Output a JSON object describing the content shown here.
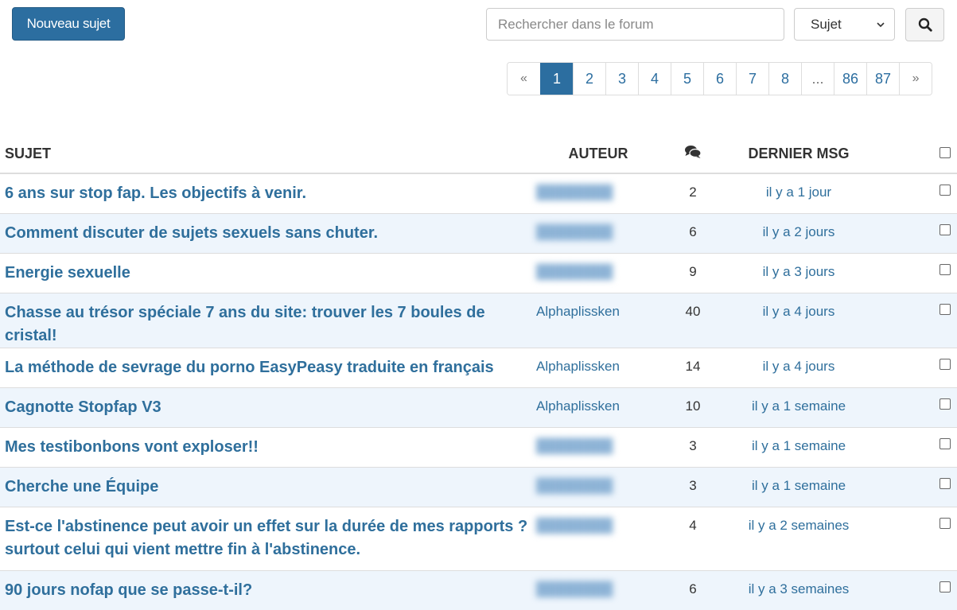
{
  "toolbar": {
    "new_topic_label": "Nouveau sujet",
    "search_placeholder": "Rechercher dans le forum",
    "search_scope_value": "Sujet",
    "search_button_icon": "search-icon"
  },
  "pagination": {
    "prev": "«",
    "next": "»",
    "pages": [
      "1",
      "2",
      "3",
      "4",
      "5",
      "6",
      "7",
      "8",
      "...",
      "86",
      "87"
    ],
    "current": "1"
  },
  "table": {
    "headers": {
      "subject": "SUJET",
      "author": "AUTEUR",
      "replies_icon": "comments-icon",
      "last": "DERNIER MSG"
    },
    "rows": [
      {
        "subject": "6 ans sur stop fap. Les objectifs à venir.",
        "author": "",
        "author_blurred": true,
        "count": "2",
        "last": "il y a 1 jour"
      },
      {
        "subject": "Comment discuter de sujets sexuels sans chuter.",
        "author": "",
        "author_blurred": true,
        "count": "6",
        "last": "il y a 2 jours"
      },
      {
        "subject": "Energie sexuelle",
        "author": "",
        "author_blurred": true,
        "count": "9",
        "last": "il y a 3 jours"
      },
      {
        "subject": "Chasse au trésor spéciale 7 ans du site: trouver les 7 boules de cristal!",
        "author": "Alphaplissken",
        "author_blurred": false,
        "count": "40",
        "last": "il y a 4 jours"
      },
      {
        "subject": "La méthode de sevrage du porno EasyPeasy traduite en français",
        "author": "Alphaplissken",
        "author_blurred": false,
        "count": "14",
        "last": "il y a 4 jours"
      },
      {
        "subject": "Cagnotte Stopfap V3",
        "author": "Alphaplissken",
        "author_blurred": false,
        "count": "10",
        "last": "il y a 1 semaine"
      },
      {
        "subject": "Mes testibonbons vont exploser!!",
        "author": "",
        "author_blurred": true,
        "count": "3",
        "last": "il y a 1 semaine"
      },
      {
        "subject": "Cherche une Équipe",
        "author": "",
        "author_blurred": true,
        "count": "3",
        "last": "il y a 1 semaine"
      },
      {
        "subject": "Est-ce l'abstinence peut avoir un effet sur la durée de mes rapports ? surtout celui qui vient mettre fin à l'abstinence.",
        "author": "",
        "author_blurred": true,
        "count": "4",
        "last": "il y a 2 semaines"
      },
      {
        "subject": "90 jours nofap que se passe-t-il?",
        "author": "",
        "author_blurred": true,
        "count": "6",
        "last": "il y a 3 semaines"
      }
    ]
  }
}
